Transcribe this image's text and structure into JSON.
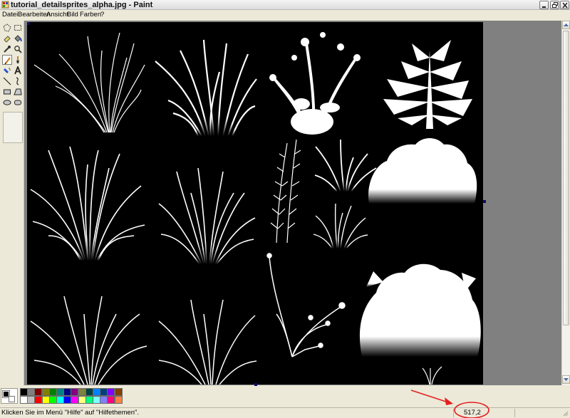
{
  "window": {
    "title": "tutorial_detailsprites_alpha.jpg - Paint",
    "controls": [
      "minimize",
      "maximize",
      "close"
    ]
  },
  "menu": [
    "Datei",
    "Bearbeiten",
    "Ansicht",
    "Bild",
    "Farben",
    "?"
  ],
  "toolbox": {
    "tools": [
      {
        "name": "free-form-select-icon"
      },
      {
        "name": "select-rectangle-icon"
      },
      {
        "name": "eraser-icon"
      },
      {
        "name": "fill-bucket-icon"
      },
      {
        "name": "pick-color-icon"
      },
      {
        "name": "magnifier-icon"
      },
      {
        "name": "pencil-icon",
        "active": true
      },
      {
        "name": "brush-icon"
      },
      {
        "name": "airbrush-icon"
      },
      {
        "name": "text-icon"
      },
      {
        "name": "line-icon"
      },
      {
        "name": "curve-icon"
      },
      {
        "name": "rectangle-icon"
      },
      {
        "name": "polygon-icon"
      },
      {
        "name": "ellipse-icon"
      },
      {
        "name": "rounded-rectangle-icon"
      }
    ]
  },
  "canvas": {
    "image_file": "tutorial_detailsprites_alpha.jpg",
    "background": "#000000",
    "sprite_color": "#ffffff",
    "workspace_color": "#808080"
  },
  "palette": {
    "foreground": "#000000",
    "background": "#ffffff",
    "colors_row1": [
      "#000000",
      "#808080",
      "#800000",
      "#808000",
      "#008000",
      "#008080",
      "#000080",
      "#800080",
      "#808040",
      "#004040",
      "#0080ff",
      "#004080",
      "#8000ff",
      "#804000"
    ],
    "colors_row2": [
      "#ffffff",
      "#c0c0c0",
      "#ff0000",
      "#ffff00",
      "#00ff00",
      "#00ffff",
      "#0000ff",
      "#ff00ff",
      "#ffff80",
      "#00ff80",
      "#80ffff",
      "#8080ff",
      "#ff0080",
      "#ff8040"
    ]
  },
  "status": {
    "help_text": "Klicken Sie im Menü \"Hilfe\" auf \"Hilfethemen\".",
    "coordinates": "517,2"
  },
  "annotation": {
    "color": "#e32020",
    "shape": "arrow-to-circle"
  }
}
